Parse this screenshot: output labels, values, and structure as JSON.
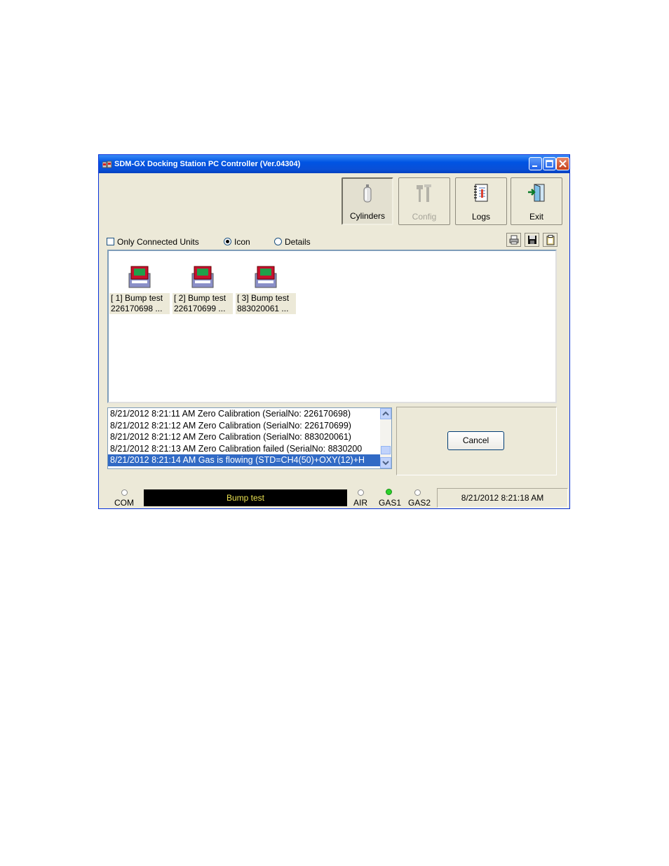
{
  "window": {
    "title": "SDM-GX Docking Station PC Controller (Ver.04304)",
    "titlebar_color": "#0054e3"
  },
  "toolbar": {
    "buttons": [
      {
        "label": "Cylinders",
        "icon": "cylinder-icon",
        "state": "pressed"
      },
      {
        "label": "Config",
        "icon": "tools-icon",
        "state": "disabled"
      },
      {
        "label": "Logs",
        "icon": "logbook-icon",
        "state": "normal"
      },
      {
        "label": "Exit",
        "icon": "exit-door-icon",
        "state": "normal"
      }
    ]
  },
  "options": {
    "only_connected_label": "Only Connected Units",
    "only_connected_checked": false,
    "view_icon_label": "Icon",
    "view_details_label": "Details",
    "view_selected": "Icon"
  },
  "units": [
    {
      "line1": "[ 1] Bump test",
      "line2": "226170698  ..."
    },
    {
      "line1": "[ 2] Bump test",
      "line2": "226170699  ..."
    },
    {
      "line1": "[ 3] Bump test",
      "line2": "883020061  ..."
    }
  ],
  "log": {
    "entries": [
      "8/21/2012 8:21:11 AM Zero Calibration (SerialNo: 226170698)",
      "8/21/2012 8:21:12 AM Zero Calibration (SerialNo: 226170699)",
      "8/21/2012 8:21:12 AM Zero Calibration (SerialNo: 883020061)",
      "8/21/2012 8:21:13 AM Zero Calibration failed (SerialNo: 8830200",
      "8/21/2012 8:21:14 AM Gas is flowing (STD=CH4(50)+OXY(12)+H"
    ],
    "selected_index": 4
  },
  "cancel_label": "Cancel",
  "status": {
    "com_label": "COM",
    "display_text": "Bump test",
    "air_label": "AIR",
    "gas1_label": "GAS1",
    "gas2_label": "GAS2",
    "gas1_on": true,
    "datetime": "8/21/2012 8:21:18 AM"
  }
}
